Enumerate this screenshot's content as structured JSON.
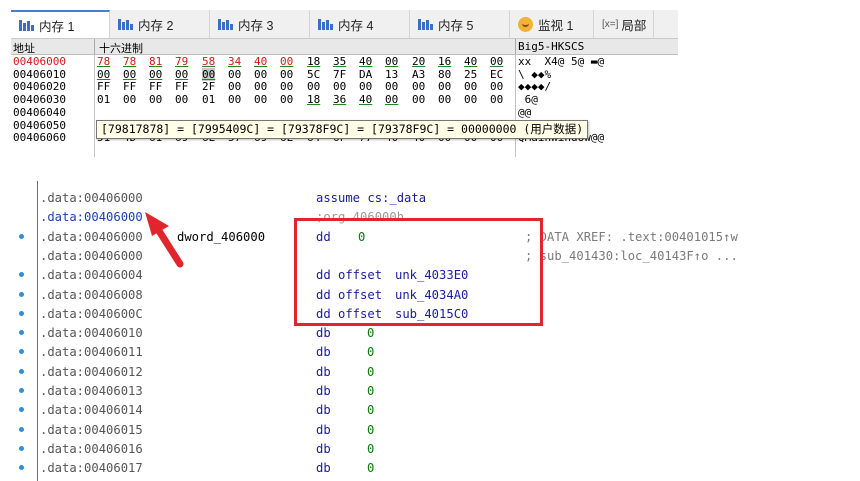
{
  "dump": {
    "tabs": [
      {
        "label": "内存 1",
        "icon": "memory-icon",
        "active": true
      },
      {
        "label": "内存 2",
        "icon": "memory-icon",
        "active": false
      },
      {
        "label": "内存 3",
        "icon": "memory-icon",
        "active": false
      },
      {
        "label": "内存 4",
        "icon": "memory-icon",
        "active": false
      },
      {
        "label": "内存 5",
        "icon": "memory-icon",
        "active": false
      },
      {
        "label": "监视 1",
        "icon": "watch-icon",
        "active": false
      },
      {
        "label": "局部",
        "icon": "locals-icon",
        "active": false
      }
    ],
    "locals_glyph": "[x=]",
    "header": {
      "address": "地址",
      "hex": "十六进制",
      "ascii": "Big5-HKSCS"
    },
    "rows": [
      {
        "address": "00406000",
        "bytes": [
          "78",
          "78",
          "81",
          "79",
          "58",
          "34",
          "40",
          "00",
          "18",
          "35",
          "40",
          "00",
          "20",
          "16",
          "40",
          "00"
        ],
        "ascii": "xx  X4@ 5@ ▬@"
      },
      {
        "address": "00406010",
        "bytes": [
          "00",
          "00",
          "00",
          "00",
          "00",
          "00",
          "00",
          "00",
          "5C",
          "7F",
          "DA",
          "13",
          "A3",
          "80",
          "25",
          "EC"
        ],
        "ascii": "\\ ◆◆%"
      },
      {
        "address": "00406020",
        "bytes": [
          "FF",
          "FF",
          "FF",
          "FF",
          "2F",
          "00",
          "00",
          "00",
          "00",
          "00",
          "00",
          "00",
          "00",
          "00",
          "00",
          "00"
        ],
        "ascii": "◆◆◆◆/"
      },
      {
        "address": "00406030",
        "bytes": [
          "01",
          "00",
          "00",
          "00",
          "01",
          "00",
          "00",
          "00",
          "18",
          "36",
          "40",
          "00",
          "00",
          "00",
          "00",
          "00"
        ],
        "ascii": " 6@"
      },
      {
        "address": "00406040",
        "bytes": [
          "",
          "",
          "",
          "",
          "",
          "",
          "",
          "",
          "",
          "",
          "",
          "",
          "",
          "",
          "",
          ""
        ],
        "ascii": "@@"
      },
      {
        "address": "00406050",
        "bytes": [
          "",
          "",
          "",
          "",
          "",
          "",
          "",
          "",
          "",
          "",
          "",
          "",
          "",
          "",
          "",
          ""
        ],
        "ascii": ""
      },
      {
        "address": "00406060",
        "bytes": [
          "51",
          "4D",
          "61",
          "69",
          "6E",
          "57",
          "69",
          "6E",
          "64",
          "6F",
          "77",
          "40",
          "40",
          "00",
          "00",
          "00"
        ],
        "ascii": "QMainWindow@@"
      }
    ],
    "tooltip": "[79817878] = [7995409C] = [79378F9C] = [79378F9C] = 00000000 (用户数据)"
  },
  "ida": {
    "rows": [
      {
        "bullet": false,
        "address": ".data:00406000",
        "label": "",
        "op": "assume cs:_data",
        "arg": "",
        "comment": ""
      },
      {
        "bullet": false,
        "address": ".data:00406000",
        "label": "",
        "op": ";org 406000h",
        "arg": "",
        "comment": "",
        "cyan": true
      },
      {
        "bullet": true,
        "address": ".data:00406000",
        "label": "dword_406000",
        "op": "dd",
        "arg": "0",
        "comment": "; DATA XREF: .text:00401015↑w"
      },
      {
        "bullet": false,
        "address": ".data:00406000",
        "label": "",
        "op": "",
        "arg": "",
        "comment": "; sub_401430:loc_40143F↑o ..."
      },
      {
        "bullet": true,
        "address": ".data:00406004",
        "label": "",
        "op": "dd offset",
        "arg": "unk_4033E0",
        "comment": ""
      },
      {
        "bullet": true,
        "address": ".data:00406008",
        "label": "",
        "op": "dd offset",
        "arg": "unk_4034A0",
        "comment": ""
      },
      {
        "bullet": true,
        "address": ".data:0040600C",
        "label": "",
        "op": "dd offset",
        "arg": "sub_4015C0",
        "comment": ""
      },
      {
        "bullet": true,
        "address": ".data:00406010",
        "label": "",
        "op": "db",
        "arg": "0",
        "comment": ""
      },
      {
        "bullet": true,
        "address": ".data:00406011",
        "label": "",
        "op": "db",
        "arg": "0",
        "comment": ""
      },
      {
        "bullet": true,
        "address": ".data:00406012",
        "label": "",
        "op": "db",
        "arg": "0",
        "comment": ""
      },
      {
        "bullet": true,
        "address": ".data:00406013",
        "label": "",
        "op": "db",
        "arg": "0",
        "comment": ""
      },
      {
        "bullet": true,
        "address": ".data:00406014",
        "label": "",
        "op": "db",
        "arg": "0",
        "comment": ""
      },
      {
        "bullet": true,
        "address": ".data:00406015",
        "label": "",
        "op": "db",
        "arg": "0",
        "comment": ""
      },
      {
        "bullet": true,
        "address": ".data:00406016",
        "label": "",
        "op": "db",
        "arg": "0",
        "comment": ""
      },
      {
        "bullet": true,
        "address": ".data:00406017",
        "label": "",
        "op": "db",
        "arg": "0",
        "comment": ""
      }
    ]
  },
  "colors": {
    "accent": "#e0262c",
    "address_red": "#d01818",
    "hex_green": "#1a8a1a",
    "tooltip_bg": "#ffffe8"
  }
}
